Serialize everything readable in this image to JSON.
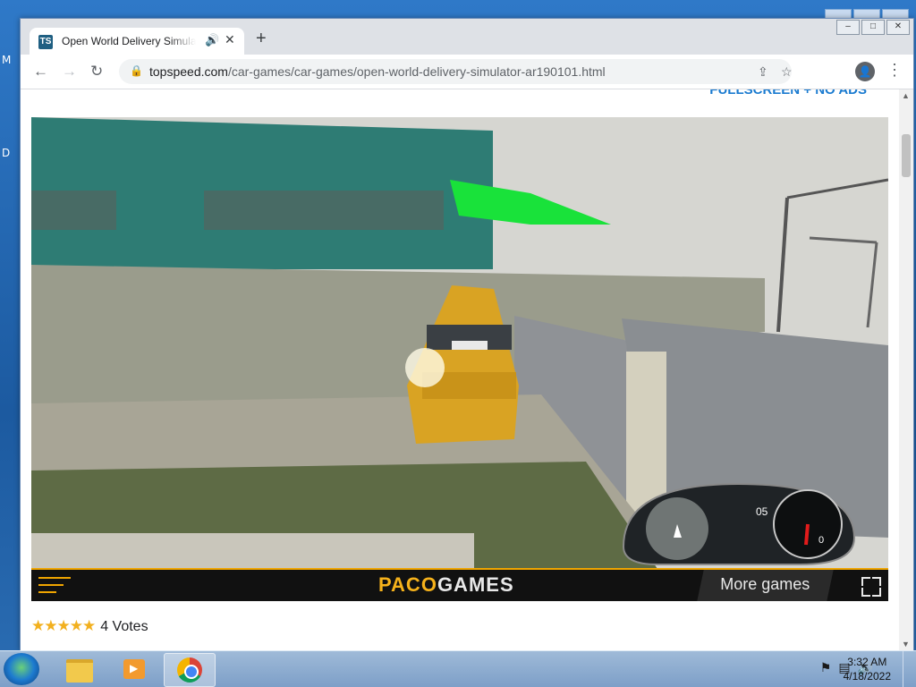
{
  "desktop": {
    "edge_letters": [
      "M",
      "D"
    ]
  },
  "browser": {
    "tab": {
      "title": "Open World Delivery Simulator",
      "favicon_text": "TS",
      "audio_icon": "speaker-icon"
    },
    "new_tab_label": "+",
    "url": {
      "domain": "topspeed.com",
      "path": "/car-games/car-games/open-world-delivery-simulator-ar190101.html"
    },
    "window_controls": [
      "minimize",
      "maximize",
      "close"
    ]
  },
  "page": {
    "fullscreen_link": "FULLSCREEN + NO ADS",
    "game_bar": {
      "logo_part1": "PACO",
      "logo_part2": "GAMES",
      "more_games": "More games"
    },
    "rating": {
      "stars": "★★★★★",
      "votes": "4 Votes"
    }
  },
  "hud": {
    "gear": "05",
    "speed": "0"
  },
  "taskbar": {
    "clock_time": "3:32 AM",
    "clock_date": "4/18/2022",
    "apps": [
      "file-explorer",
      "media-player",
      "chrome"
    ]
  },
  "colors": {
    "accent": "#f0a500",
    "link": "#1b7bd0",
    "arrow": "#19e23a",
    "taxi": "#d9a323"
  }
}
